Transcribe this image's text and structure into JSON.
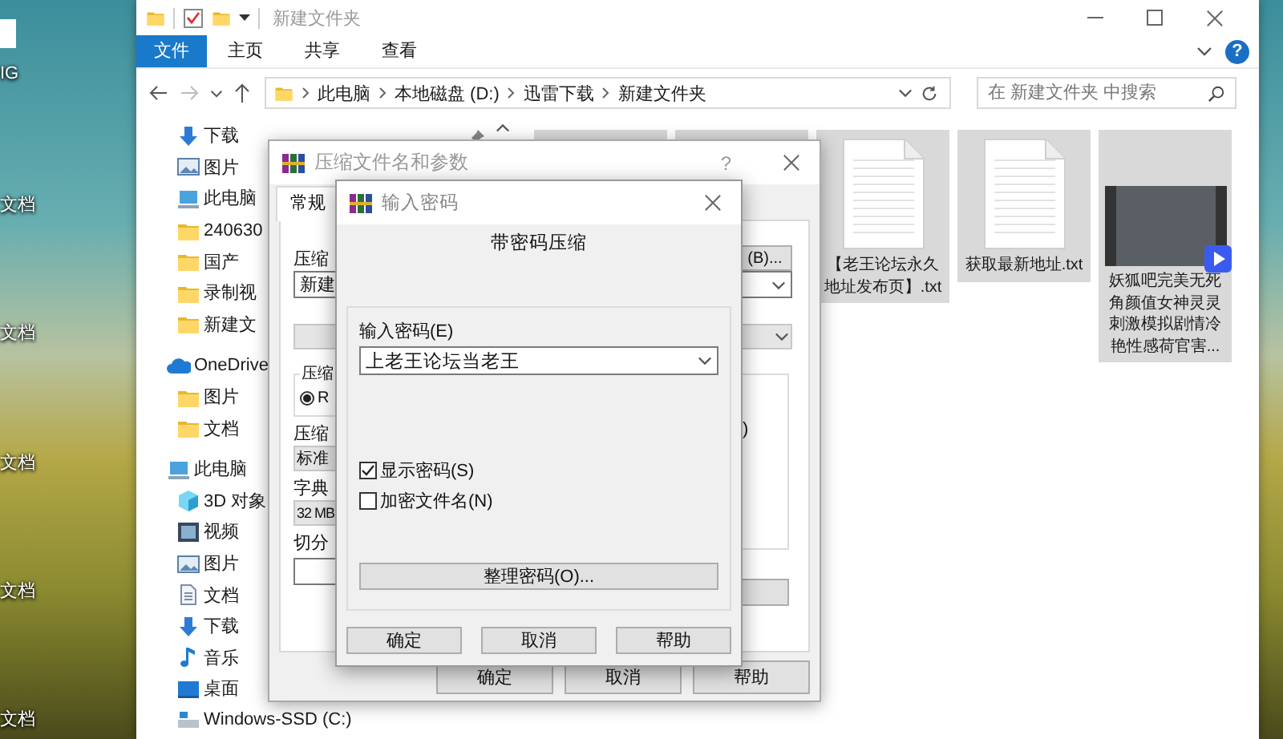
{
  "desktop": {
    "icon_labels": [
      "IG",
      "文档",
      "文档",
      "文档",
      "文档",
      "文档"
    ]
  },
  "explorer": {
    "title": "新建文件夹",
    "ribbon_tabs": [
      {
        "label": "文件",
        "selected": true
      },
      {
        "label": "主页",
        "selected": false
      },
      {
        "label": "共享",
        "selected": false
      },
      {
        "label": "查看",
        "selected": false
      }
    ],
    "help": "?",
    "breadcrumb": [
      "此电脑",
      "本地磁盘 (D:)",
      "迅雷下载",
      "新建文件夹"
    ],
    "search": {
      "placeholder": "在 新建文件夹 中搜索"
    },
    "quick_access": [
      {
        "label": "下载",
        "kind": "download"
      },
      {
        "label": "图片",
        "kind": "pictures"
      },
      {
        "label": "此电脑",
        "kind": "pc"
      },
      {
        "label": "240630",
        "kind": "folder"
      },
      {
        "label": "国产",
        "kind": "folder"
      },
      {
        "label": "录制视",
        "kind": "folder"
      },
      {
        "label": "新建文",
        "kind": "folder"
      }
    ],
    "tree": [
      {
        "label": "OneDrive",
        "kind": "cloud",
        "children": [
          {
            "label": "图片",
            "kind": "folder"
          },
          {
            "label": "文档",
            "kind": "folder"
          }
        ]
      },
      {
        "label": "此电脑",
        "kind": "pc",
        "children": [
          {
            "label": "3D 对象",
            "kind": "objects3d"
          },
          {
            "label": "视频",
            "kind": "video"
          },
          {
            "label": "图片",
            "kind": "pictures"
          },
          {
            "label": "文档",
            "kind": "docs"
          },
          {
            "label": "下载",
            "kind": "download"
          },
          {
            "label": "音乐",
            "kind": "music"
          },
          {
            "label": "桌面",
            "kind": "desktop"
          },
          {
            "label": "Windows-SSD (C:)",
            "kind": "drive"
          }
        ]
      }
    ],
    "files": [
      {
        "kind": "covered",
        "selected": true
      },
      {
        "kind": "covered",
        "selected": true
      },
      {
        "kind": "text",
        "name": "【老王论坛永久地址发布页】.txt",
        "selected": true
      },
      {
        "kind": "text",
        "name": "获取最新地址.txt",
        "selected": true
      },
      {
        "kind": "video",
        "name": "妖狐吧完美无死角颜值女神灵灵刺激模拟剧情冷艳性感荷官害...",
        "selected": true
      }
    ]
  },
  "archive_dialog": {
    "title": "压缩文件名和参数",
    "help": "?",
    "tabs": [
      {
        "label": "常规",
        "selected": true
      }
    ],
    "archive_name_label": "压缩",
    "archive_name": "新建",
    "browse_button": "(B)...",
    "format_group": "压缩",
    "format_option": {
      "label": "R",
      "selected": true
    },
    "method_label": "压缩",
    "method": "标准",
    "dictionary_label": "字典",
    "dictionary": "32 MB",
    "split_label": "切分",
    "options_group_tail": ")",
    "buttons": [
      "确定",
      "取消",
      "帮助"
    ]
  },
  "password_dialog": {
    "title": "输入密码",
    "heading": "带密码压缩",
    "password_label": "输入密码(E)",
    "password": "上老王论坛当老王",
    "options": [
      {
        "label": "显示密码(S)",
        "checked": true
      },
      {
        "label": "加密文件名(N)",
        "checked": false
      }
    ],
    "organize_button": "整理密码(O)...",
    "buttons": [
      "确定",
      "取消",
      "帮助"
    ]
  }
}
